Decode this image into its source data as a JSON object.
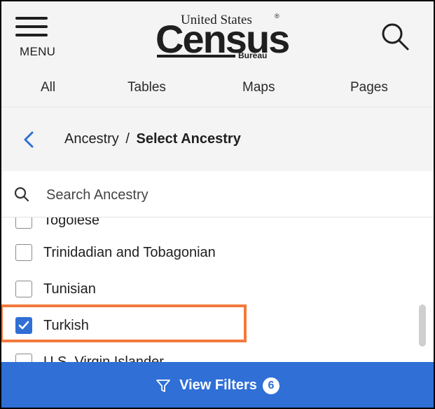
{
  "header": {
    "menu_label": "MENU",
    "logo": {
      "top_text": "United States",
      "registered": "®",
      "main_text": "Census",
      "sub_text": "Bureau"
    },
    "search_icon": "search-icon"
  },
  "tabs": [
    {
      "label": "All"
    },
    {
      "label": "Tables"
    },
    {
      "label": "Maps"
    },
    {
      "label": "Pages"
    }
  ],
  "breadcrumb": {
    "parent": "Ancestry",
    "separator": "/",
    "current": "Select Ancestry"
  },
  "search": {
    "placeholder": "Search Ancestry",
    "value": ""
  },
  "list": {
    "items": [
      {
        "label": "Togolese",
        "checked": false
      },
      {
        "label": "Trinidadian and Tobagonian",
        "checked": false
      },
      {
        "label": "Tunisian",
        "checked": false
      },
      {
        "label": "Turkish",
        "checked": true
      },
      {
        "label": "U.S. Virgin Islander",
        "checked": false
      }
    ]
  },
  "footer": {
    "label": "View Filters",
    "count": "6"
  },
  "colors": {
    "accent": "#2f6fd6",
    "highlight": "#f27a3d"
  }
}
